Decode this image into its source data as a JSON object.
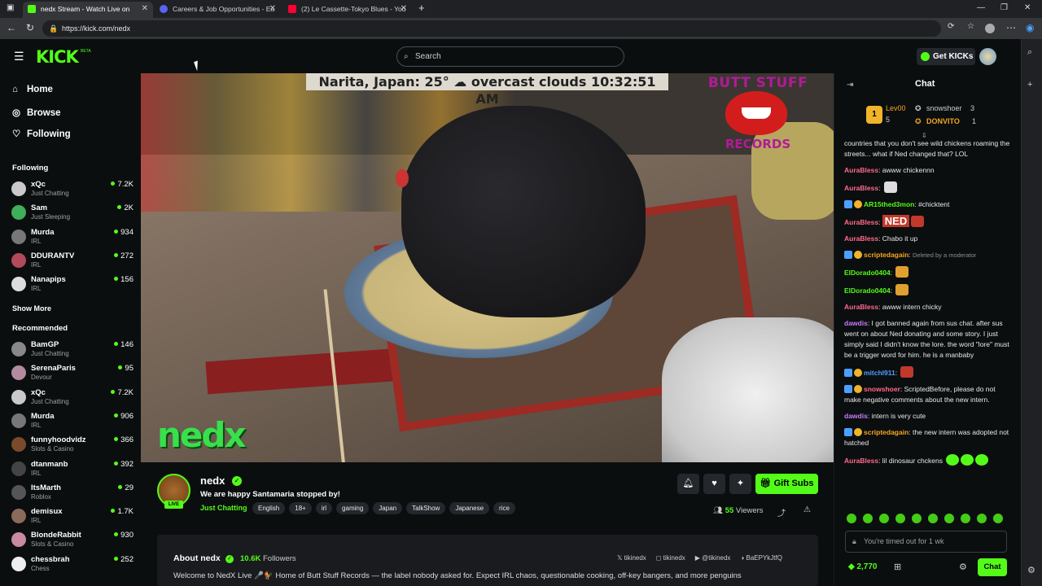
{
  "browser": {
    "tabs": [
      {
        "title": "nedx Stream - Watch Live on",
        "active": true
      },
      {
        "title": "Careers & Job Opportunities - Ea",
        "active": false
      },
      {
        "title": "(2) Le Cassette-Tokyo Blues - You",
        "active": false
      }
    ],
    "url": "https://kick.com/nedx"
  },
  "header": {
    "logo": "KICK",
    "beta": "BETA",
    "search_placeholder": "Search",
    "get_kicks": "Get KICKs"
  },
  "sidebar": {
    "nav": [
      {
        "label": "Home",
        "icon": "home-icon"
      },
      {
        "label": "Browse",
        "icon": "compass-icon"
      },
      {
        "label": "Following",
        "icon": "heart-icon"
      }
    ],
    "following_title": "Following",
    "following": [
      {
        "name": "xQc",
        "category": "Just Chatting",
        "viewers": "7.2K",
        "color": "#c9c9c9"
      },
      {
        "name": "Sam",
        "category": "Just Sleeping",
        "viewers": "2K",
        "color": "#3fae5a"
      },
      {
        "name": "Murda",
        "category": "IRL",
        "viewers": "934",
        "color": "#777"
      },
      {
        "name": "DDURANTV",
        "category": "IRL",
        "viewers": "272",
        "color": "#b24a5a"
      },
      {
        "name": "Nanapips",
        "category": "IRL",
        "viewers": "156",
        "color": "#ddd"
      }
    ],
    "show_more": "Show More",
    "recommended_title": "Recommended",
    "recommended": [
      {
        "name": "BamGP",
        "category": "Just Chatting",
        "viewers": "146",
        "color": "#888"
      },
      {
        "name": "SerenaParis",
        "category": "Devour",
        "viewers": "95",
        "color": "#b48aa0"
      },
      {
        "name": "xQc",
        "category": "Just Chatting",
        "viewers": "7.2K",
        "color": "#c9c9c9"
      },
      {
        "name": "Murda",
        "category": "IRL",
        "viewers": "906",
        "color": "#777"
      },
      {
        "name": "funnyhoodvidz",
        "category": "Slots & Casino",
        "viewers": "366",
        "color": "#7a4a2a"
      },
      {
        "name": "dtanmanb",
        "category": "IRL",
        "viewers": "392",
        "color": "#444"
      },
      {
        "name": "ItsMarth",
        "category": "Roblox",
        "viewers": "29",
        "color": "#555"
      },
      {
        "name": "demisux",
        "category": "IRL",
        "viewers": "1.7K",
        "color": "#8a6a5a"
      },
      {
        "name": "BlondeRabbit",
        "category": "Slots & Casino",
        "viewers": "930",
        "color": "#c88aa0"
      },
      {
        "name": "chessbrah",
        "category": "Chess",
        "viewers": "252",
        "color": "#eee"
      }
    ]
  },
  "video": {
    "weather_overlay": "Narita, Japan: 25° ☁ overcast clouds 10:32:51 AM",
    "brand_top": "BUTT STUFF",
    "brand_bottom": "RECORDS",
    "watermark": "nedx"
  },
  "stream": {
    "channel": "nedx",
    "live": "LIVE",
    "title": "We are happy Santamaria stopped by!",
    "category": "Just Chatting",
    "tags": [
      "English",
      "18+",
      "irl",
      "gaming",
      "Japan",
      "TalkShow",
      "Japanese",
      "rice"
    ],
    "gift_subs": "Gift Subs",
    "viewers_count": "55",
    "viewers_label": "Viewers"
  },
  "about": {
    "title": "About nedx",
    "followers_count": "10.6K",
    "followers_label": "Followers",
    "socials": [
      "tikinedx",
      "tikinedx",
      "@tikinedx",
      "BaEPYkJtfQ"
    ],
    "description": "Welcome to NedX Live 🎤🐓 Home of Butt Stuff Records — the label nobody asked for. Expect IRL chaos, questionable cooking, off-key bangers, and more penguins"
  },
  "chat": {
    "title": "Chat",
    "gifters": [
      {
        "name": "Lev00",
        "count": "5"
      },
      {
        "name": "snowshoer",
        "count": "3"
      },
      {
        "name": "DONVITO",
        "count": "1"
      }
    ],
    "messages": [
      {
        "user": "",
        "text": "countries that you don't see wild chickens roaming the streets... what if Ned changed that? LOL",
        "color": "#e8e8e8"
      },
      {
        "user": "AuraBless",
        "text": "awww chickennn",
        "color": "#ff6b8a"
      },
      {
        "user": "AuraBless",
        "text": "",
        "color": "#ff6b8a"
      },
      {
        "user": "AR15thed3mon",
        "text": "#chicktent",
        "color": "#53fc18"
      },
      {
        "user": "AuraBless",
        "text": "NED",
        "color": "#ff6b8a"
      },
      {
        "user": "AuraBless",
        "text": "Chabo it up",
        "color": "#ff6b8a"
      },
      {
        "user": "scriptedagain",
        "text": "Deleted by a moderator",
        "color": "#f6a623"
      },
      {
        "user": "ElDorado0404",
        "text": "",
        "color": "#53fc18"
      },
      {
        "user": "ElDorado0404",
        "text": "",
        "color": "#53fc18"
      },
      {
        "user": "AuraBless",
        "text": "awww intern chicky",
        "color": "#ff6b8a"
      },
      {
        "user": "dawdis",
        "text": "I got banned again from sus chat. after sus went on about Ned donating and some story. I just simply said I didn't know the lore. the word \"lore\" must be a trigger word for him. he is a manbaby",
        "color": "#c77dff"
      },
      {
        "user": "mitchl911",
        "text": "",
        "color": "#4d9fff"
      },
      {
        "user": "snowshoer",
        "text": "ScriptedBefore, please do not make negative comments about the new intern.",
        "color": "#ff6b8a"
      },
      {
        "user": "dawdis",
        "text": "intern is very cute",
        "color": "#c77dff"
      },
      {
        "user": "scriptedagain",
        "text": "the new intern was adopted not hatched",
        "color": "#f6a623"
      },
      {
        "user": "AuraBless",
        "text": "lil dinosaur chckens",
        "color": "#ff6b8a"
      }
    ],
    "input_placeholder": "You're timed out for 1 wk",
    "kicks_balance": "2,770",
    "send": "Chat"
  }
}
